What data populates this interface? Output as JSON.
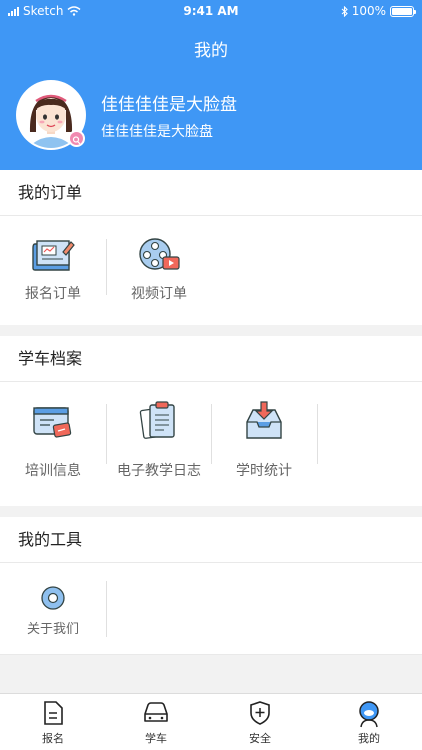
{
  "status_bar": {
    "carrier": "Sketch",
    "time": "9:41 AM",
    "battery": "100%"
  },
  "header": {
    "title": "我的"
  },
  "profile": {
    "name": "佳佳佳佳是大脸盘",
    "subtitle": "佳佳佳佳是大脸盘"
  },
  "orders": {
    "title": "我的订单",
    "items": [
      {
        "label": "报名订单",
        "icon": "enrollment-order-icon"
      },
      {
        "label": "视频订单",
        "icon": "video-order-icon"
      }
    ]
  },
  "records": {
    "title": "学车档案",
    "items": [
      {
        "label": "培训信息",
        "icon": "training-info-icon"
      },
      {
        "label": "电子教学日志",
        "icon": "teaching-log-icon"
      },
      {
        "label": "学时统计",
        "icon": "study-hours-icon"
      }
    ]
  },
  "tools": {
    "title": "我的工具",
    "items": [
      {
        "label": "关于我们",
        "icon": "about-us-icon"
      }
    ]
  },
  "tabbar": {
    "items": [
      {
        "label": "报名",
        "icon": "document-icon"
      },
      {
        "label": "学车",
        "icon": "car-icon"
      },
      {
        "label": "安全",
        "icon": "shield-icon"
      },
      {
        "label": "我的",
        "icon": "profile-icon"
      }
    ]
  },
  "colors": {
    "primary": "#3f97f5",
    "background": "#f2f2f2"
  }
}
